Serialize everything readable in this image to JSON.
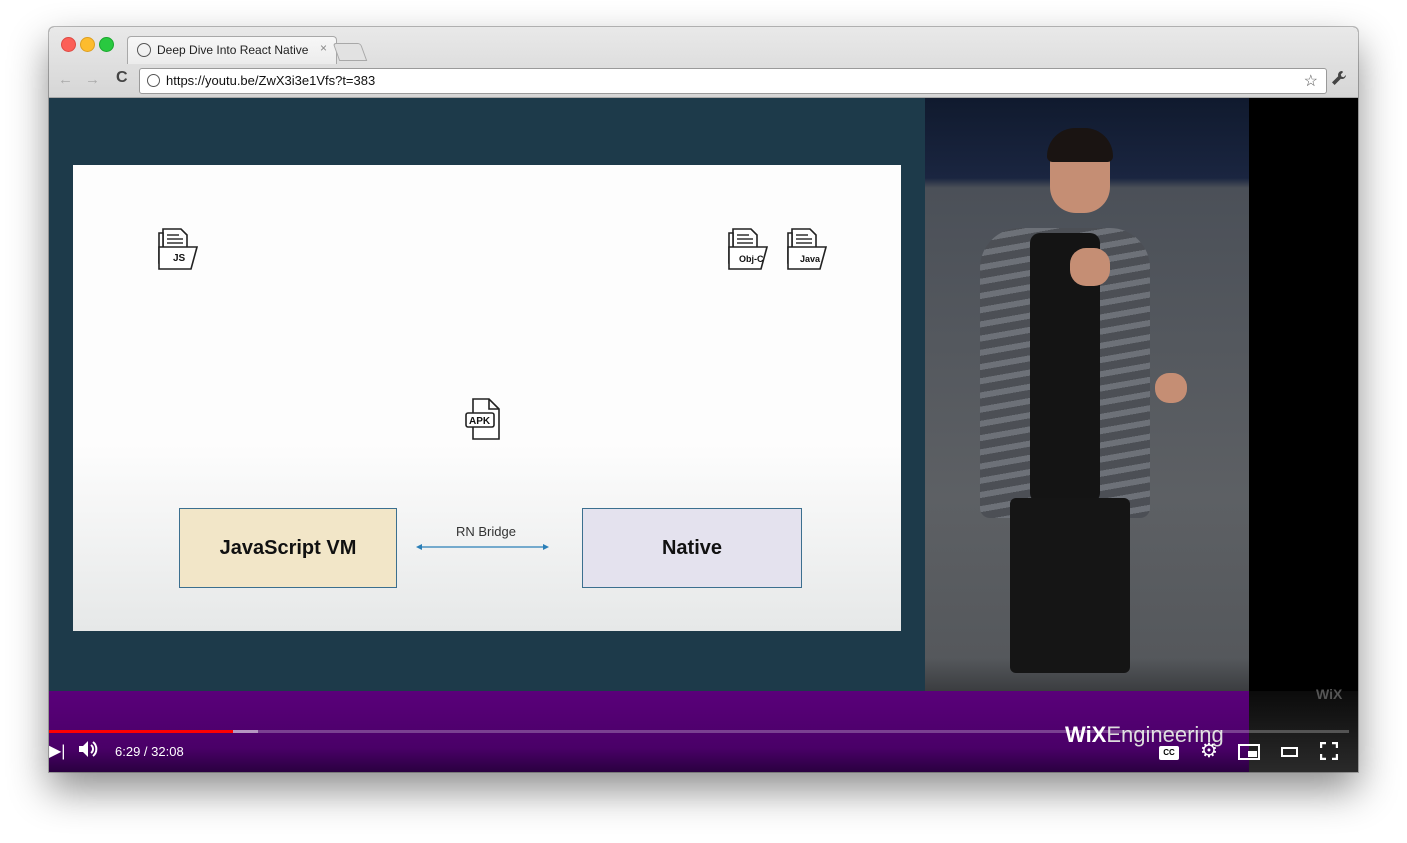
{
  "browser": {
    "tab_title": "Deep Dive Into React Native",
    "tab_close": "×",
    "url": "https://youtu.be/ZwX3i3e1Vfs?t=383",
    "back_icon": "←",
    "forward_icon": "→",
    "reload_icon": "C",
    "star_icon": "☆",
    "wrench_icon": "🔧",
    "globe_icon": "globe-icon"
  },
  "slide": {
    "js_file_label": "JS",
    "objc_file_label": "Obj-C",
    "java_file_label": "Java",
    "apk_label": "APK",
    "js_vm_label": "JavaScript VM",
    "native_label": "Native",
    "bridge_label": "RN Bridge"
  },
  "branding": {
    "wix_small": "WiX",
    "wix_logo_bold": "WiX",
    "wix_logo_rest": "Engineering"
  },
  "player": {
    "time_display": "6:29 / 32:08",
    "cc_label": "CC",
    "progress_played_fraction": 0.2018,
    "accent_red": "#ff0000"
  },
  "colors": {
    "stage_bg": "#1d3a4a",
    "js_box": "#f2e6c8",
    "native_box": "#e4e2ee",
    "lower_third": "#5a007a"
  }
}
